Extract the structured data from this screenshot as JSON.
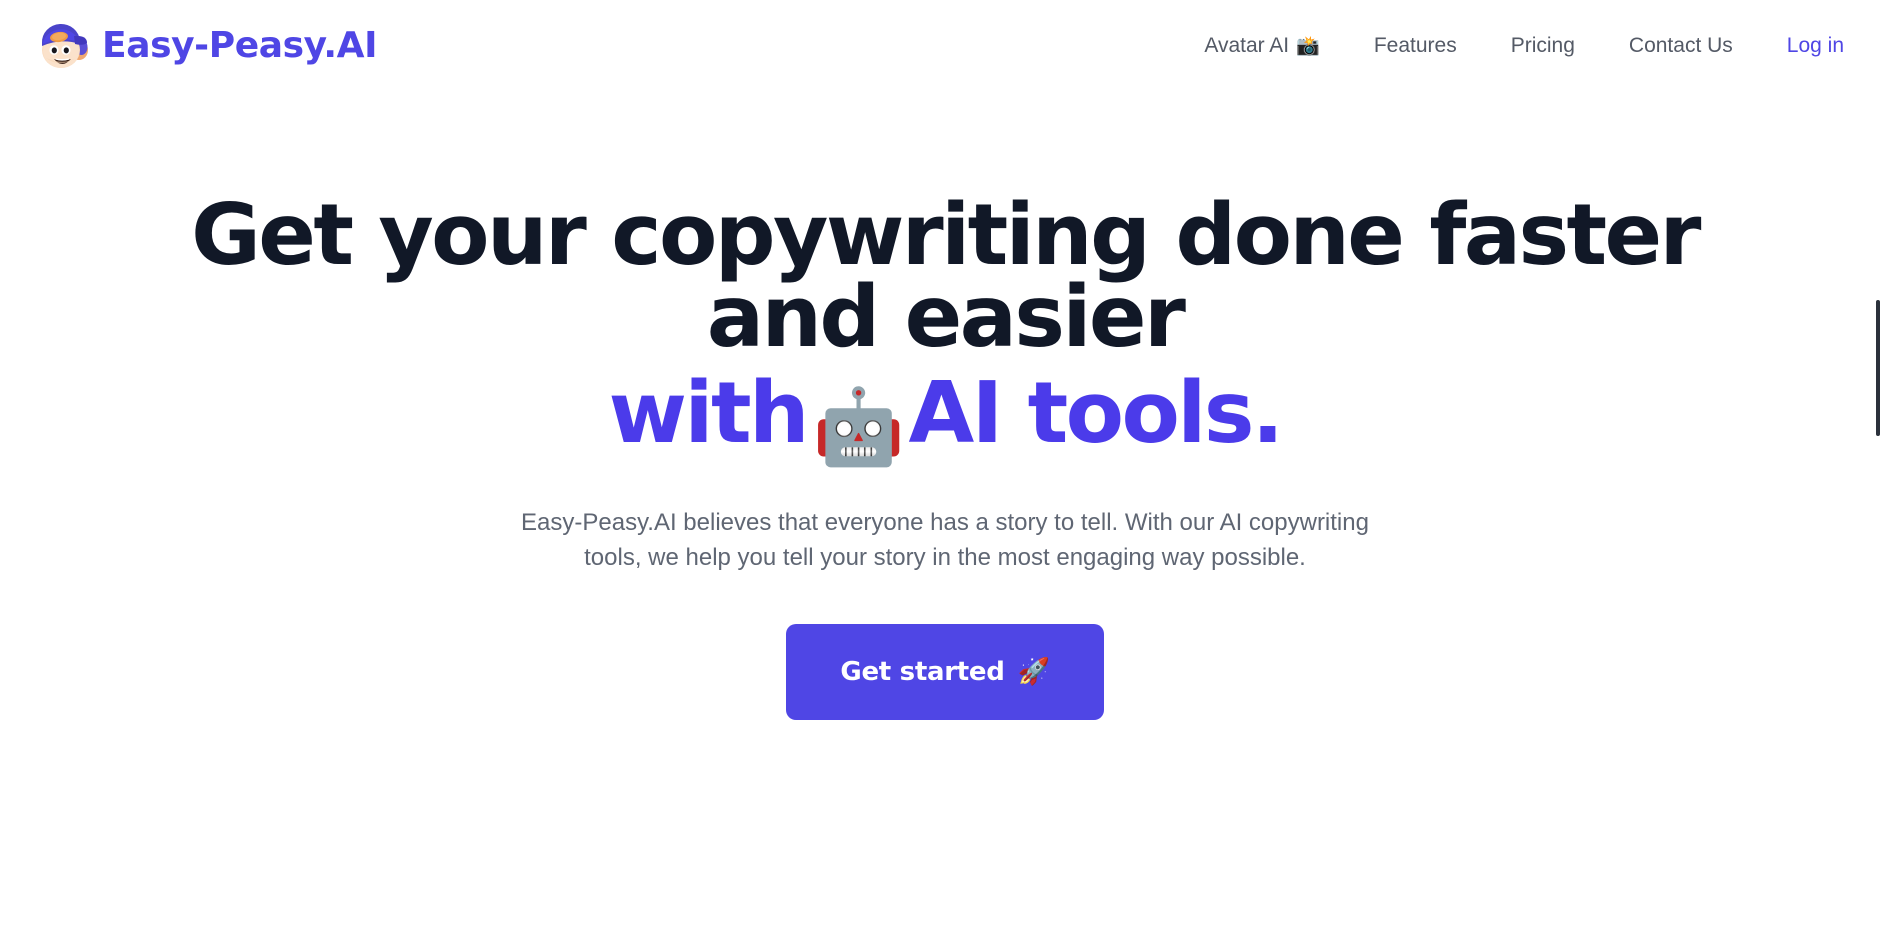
{
  "colors": {
    "accent": "#4f46e5",
    "heading": "#111827",
    "heading_accent": "#4b3bea",
    "body_text": "#5f6673",
    "nav_text": "#545a66",
    "background": "#ffffff",
    "scrollbar_thumb": "#2b313b"
  },
  "header": {
    "brand": {
      "logo_icon": "easy-peasy-face-logo",
      "name": "Easy-Peasy.AI"
    },
    "nav": [
      {
        "label": "Avatar AI",
        "emoji": "📸",
        "emoji_name": "camera-with-flash-icon",
        "accent": false
      },
      {
        "label": "Features",
        "emoji": "",
        "emoji_name": "",
        "accent": false
      },
      {
        "label": "Pricing",
        "emoji": "",
        "emoji_name": "",
        "accent": false
      },
      {
        "label": "Contact Us",
        "emoji": "",
        "emoji_name": "",
        "accent": false
      },
      {
        "label": "Log in",
        "emoji": "",
        "emoji_name": "",
        "accent": true
      }
    ]
  },
  "hero": {
    "title_line1": "Get your copywriting done faster and easier",
    "title_line2_prefix": "with",
    "title_line2_emoji": "🤖",
    "title_line2_emoji_name": "robot-face-icon",
    "title_line2_suffix": "AI tools.",
    "subtitle": "Easy-Peasy.AI believes that everyone has a story to tell. With our AI copywriting tools, we help you tell your story in the most engaging way possible.",
    "cta_label": "Get started",
    "cta_emoji": "🚀",
    "cta_emoji_name": "rocket-icon"
  },
  "scrollbar": {
    "name": "page-scrollbar"
  }
}
